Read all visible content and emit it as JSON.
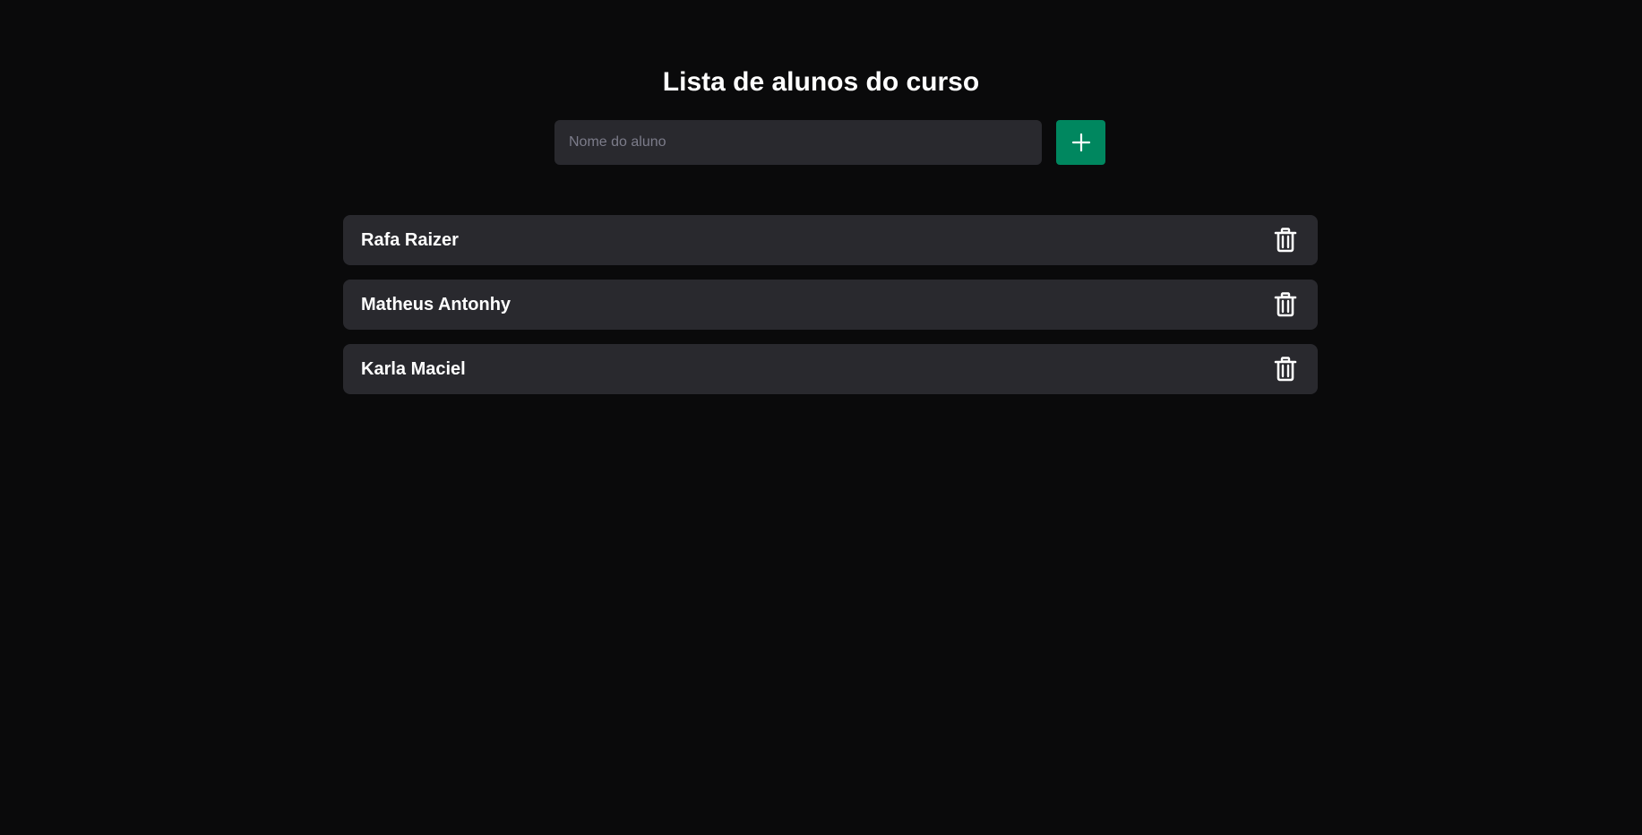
{
  "page": {
    "title": "Lista de alunos do curso"
  },
  "form": {
    "input_placeholder": "Nome do aluno",
    "input_value": "",
    "add_icon": "plus-icon"
  },
  "students": [
    {
      "name": "Rafa Raizer",
      "delete_icon": "trash-icon"
    },
    {
      "name": "Matheus Antonhy",
      "delete_icon": "trash-icon"
    },
    {
      "name": "Karla Maciel",
      "delete_icon": "trash-icon"
    }
  ],
  "colors": {
    "background": "#0a0a0b",
    "surface": "#29292e",
    "accent": "#00875f",
    "text": "#ffffff",
    "placeholder": "#7c7c8a"
  }
}
